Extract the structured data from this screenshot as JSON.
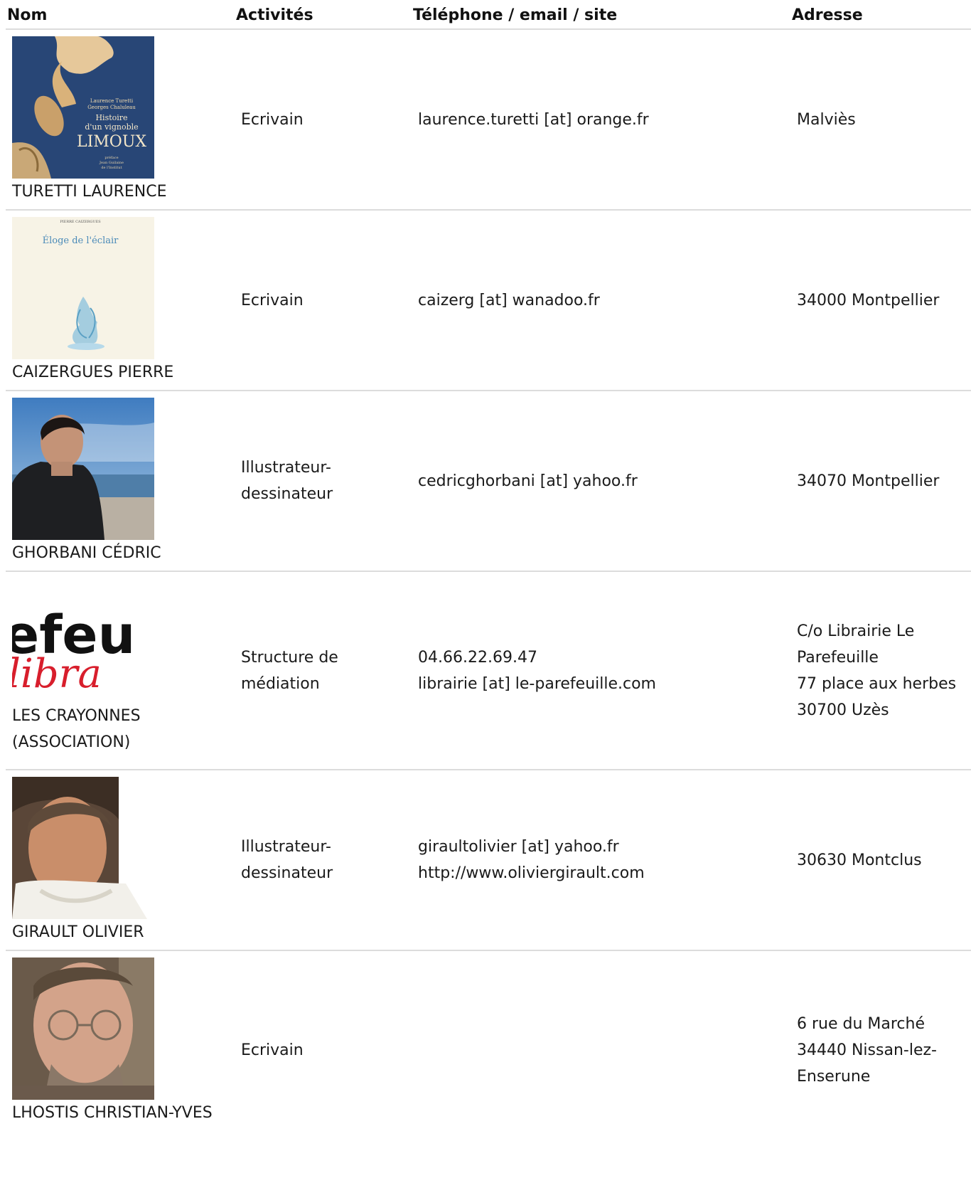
{
  "headers": {
    "name": "Nom",
    "activities": "Activités",
    "contact": "Téléphone / email / site",
    "address": "Adresse"
  },
  "rows": [
    {
      "name": "TURETTI LAURENCE",
      "activity": "Ecrivain",
      "contact": [
        "laurence.turetti [at] orange.fr"
      ],
      "address": [
        "Malviès"
      ],
      "image": {
        "kind": "book-cover-limoux",
        "text": [
          "Laurence Turetti",
          "Georges Chaluleau",
          "Histoire",
          "d'un vignoble",
          "LIMOUX",
          "préface",
          "Jean Guilaine",
          "de l'Institut"
        ]
      }
    },
    {
      "name": "CAIZERGUES PIERRE",
      "activity": "Ecrivain",
      "contact": [
        "caizerg [at] wanadoo.fr"
      ],
      "address": [
        "34000 Montpellier"
      ],
      "image": {
        "kind": "book-cover-eloge",
        "text": [
          "PIERRE CAIZERGUES",
          "Éloge de l'éclair"
        ]
      }
    },
    {
      "name": "GHORBANI CÉDRIC",
      "activity": "Illustrateur-dessinateur",
      "contact": [
        "cedricghorbani [at] yahoo.fr"
      ],
      "address": [
        "34070 Montpellier"
      ],
      "image": {
        "kind": "portrait-beach"
      }
    },
    {
      "name": "LES CRAYONNES (ASSOCIATION)",
      "activity": "Structure de médiation",
      "contact": [
        "04.66.22.69.47",
        "librairie [at] le-parefeuille.com"
      ],
      "address": [
        "C/o Librairie Le Parefeuille",
        "77 place aux herbes",
        "30700 Uzès"
      ],
      "image": {
        "kind": "logo-parefeuille",
        "text": [
          "efeu",
          "libra"
        ]
      }
    },
    {
      "name": "GIRAULT OLIVIER",
      "activity": "Illustrateur-dessinateur",
      "contact": [
        "giraultolivier [at] yahoo.fr",
        "http://www.oliviergirault.com"
      ],
      "address": [
        "30630 Montclus"
      ],
      "image": {
        "kind": "portrait-scarf"
      }
    },
    {
      "name": "LHOSTIS CHRISTIAN-YVES",
      "activity": "Ecrivain",
      "contact": [],
      "address": [
        "6 rue du Marché",
        "34440 Nissan-lez-Enserune"
      ],
      "image": {
        "kind": "portrait-glasses"
      }
    }
  ],
  "colors": {
    "rule": "#dcdcdc",
    "text": "#1a1a1a",
    "limoux_blue": "#2c4a7c",
    "logo_red": "#d81e2c"
  }
}
